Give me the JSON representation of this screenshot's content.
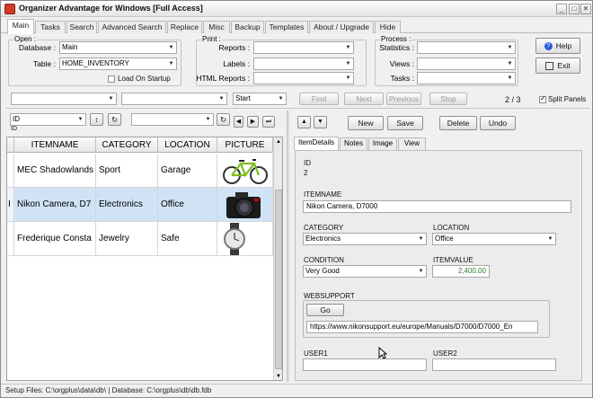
{
  "window": {
    "title": "Organizer Advantage for Windows [Full Access]"
  },
  "tabs": [
    "Main",
    "Tasks",
    "Search",
    "Advanced Search",
    "Replace",
    "Misc",
    "Backup",
    "Templates",
    "About / Upgrade",
    "Hide"
  ],
  "open_group": {
    "legend": "Open :",
    "database_label": "Database :",
    "database_value": "Main",
    "table_label": "Table :",
    "table_value": "HOME_INVENTORY",
    "load_on_startup": "Load On Startup"
  },
  "print_group": {
    "legend": "Print :",
    "reports_label": "Reports :",
    "labels_label": "Labels :",
    "html_reports_label": "HTML Reports :"
  },
  "process_group": {
    "legend": "Process :",
    "statistics_label": "Statistics :",
    "views_label": "Views :",
    "tasks_label": "Tasks :"
  },
  "side_buttons": {
    "help": "Help",
    "exit": "Exit"
  },
  "search_bar": {
    "start_value": "Start",
    "find": "Find",
    "next": "Next",
    "previous": "Previous",
    "stop": "Stop",
    "record_counter": "2 / 3",
    "split_panels": "Split Panels"
  },
  "sort_field": {
    "value": "ID",
    "sub": "ID"
  },
  "grid": {
    "columns": [
      "ITEMNAME",
      "CATEGORY",
      "LOCATION",
      "PICTURE"
    ],
    "rows": [
      {
        "name": "MEC Shadowlands",
        "category": "Sport",
        "location": "Garage",
        "picture": "bicycle"
      },
      {
        "name": "Nikon Camera, D7",
        "category": "Electronics",
        "location": "Office",
        "picture": "camera"
      },
      {
        "name": "Frederique Consta",
        "category": "Jewelry",
        "location": "Safe",
        "picture": "watch"
      }
    ],
    "row_marker": "I"
  },
  "record_toolbar": {
    "new": "New",
    "save": "Save",
    "delete": "Delete",
    "undo": "Undo"
  },
  "detail_tabs": [
    "ItemDetails",
    "Notes",
    "Image",
    "View"
  ],
  "details": {
    "id_label": "ID",
    "id_value": "2",
    "itemname_label": "ITEMNAME",
    "itemname_value": "Nikon Camera, D7000",
    "category_label": "CATEGORY",
    "category_value": "Electronics",
    "location_label": "LOCATION",
    "location_value": "Office",
    "condition_label": "CONDITION",
    "condition_value": "Very Good",
    "itemvalue_label": "ITEMVALUE",
    "itemvalue_value": "2,400.00",
    "websupport_label": "WEBSUPPORT",
    "go": "Go",
    "websupport_value": "https://www.nikonsupport.eu/europe/Manuals/D7000/D7000_En",
    "user1_label": "USER1",
    "user2_label": "USER2"
  },
  "status_bar": "Setup Files: C:\\orgplus\\data\\db\\ | Database: C:\\orgplus\\db\\db.fdb",
  "colors": {
    "selected_row": "#cfe3f4",
    "itemvalue_text": "#2e7d32"
  }
}
